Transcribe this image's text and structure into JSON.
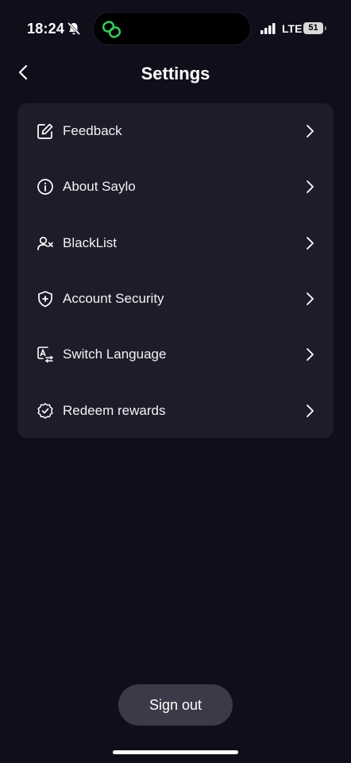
{
  "status_bar": {
    "time": "18:24",
    "network": "LTE",
    "battery": "51",
    "accent_color": "#34c759"
  },
  "header": {
    "title": "Settings",
    "back_icon": "chevron-left-icon"
  },
  "settings": {
    "items": [
      {
        "label": "Feedback",
        "icon": "edit-icon"
      },
      {
        "label": "About Saylo",
        "icon": "info-icon"
      },
      {
        "label": "BlackList",
        "icon": "user-block-icon"
      },
      {
        "label": "Account Security",
        "icon": "shield-plus-icon"
      },
      {
        "label": "Switch Language",
        "icon": "translate-icon"
      },
      {
        "label": "Redeem rewards",
        "icon": "badge-check-icon"
      }
    ]
  },
  "footer": {
    "sign_out_label": "Sign out"
  },
  "colors": {
    "background": "#0f0f1c",
    "card": "#1c1c2a",
    "button": "#3a3a48"
  }
}
